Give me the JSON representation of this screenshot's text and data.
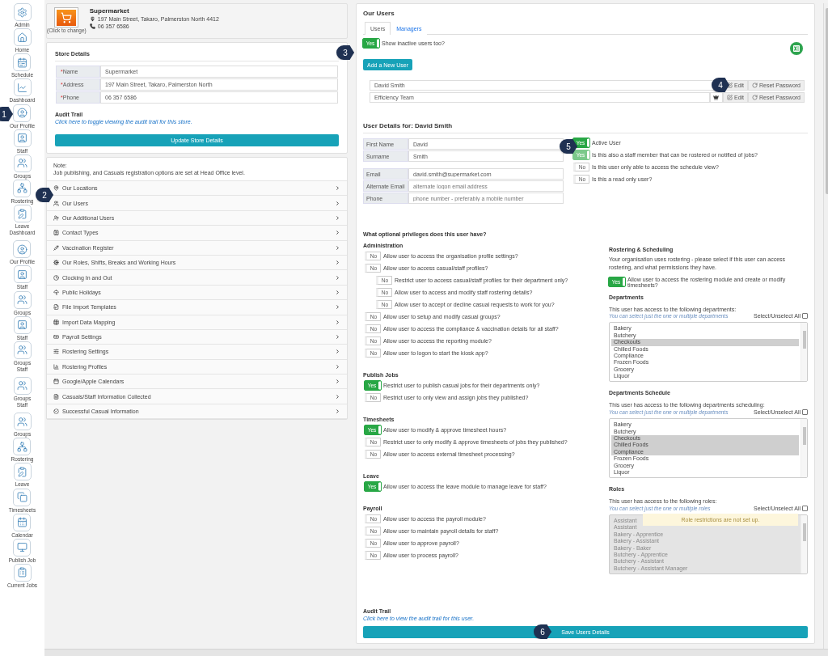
{
  "sidebar": {
    "items": [
      {
        "label": "Admin",
        "kind": "admin"
      },
      {
        "label": "Home",
        "kind": "home"
      },
      {
        "label": "Schedule",
        "kind": "schedule"
      },
      {
        "label": "Dashboard",
        "kind": "dashboard"
      },
      {
        "label": "Our Profile",
        "kind": "profile"
      },
      {
        "label": "Staff",
        "kind": "staff"
      },
      {
        "label": "Groups",
        "kind": "groups"
      },
      {
        "label": "Rostering",
        "kind": "rostering"
      },
      {
        "label": "Leave",
        "kind": "leave"
      },
      {
        "label": "Dashboard",
        "kind": "none"
      },
      {
        "label": "Our Profile",
        "kind": "profile"
      },
      {
        "label": "Staff",
        "kind": "staff"
      },
      {
        "label": "Groups",
        "kind": "groups"
      },
      {
        "label": "Staff",
        "kind": "staff"
      },
      {
        "label": "Groups",
        "kind": "groups"
      },
      {
        "label": "Staff",
        "kind": "none"
      },
      {
        "label": "Groups",
        "kind": "groups"
      },
      {
        "label": "Staff",
        "kind": "none"
      },
      {
        "label": "Groups",
        "kind": "groups"
      },
      {
        "label": "Rostering",
        "kind": "rostering"
      },
      {
        "label": "Leave",
        "kind": "leave"
      },
      {
        "label": "Timesheets",
        "kind": "timesheets"
      },
      {
        "label": "Calendar",
        "kind": "calendar"
      },
      {
        "label": "Publish Job",
        "kind": "publish"
      },
      {
        "label": "Current Jobs",
        "kind": "jobs"
      }
    ]
  },
  "store": {
    "logo_caption": "(Click to change)",
    "name": "Supermarket",
    "address": "197 Main Street, Takaro, Palmerston North 4412",
    "phone": "06 357 6586"
  },
  "store_details": {
    "title": "Store Details",
    "fields": [
      {
        "mark": "*",
        "label": "Name",
        "value": "Supermarket"
      },
      {
        "mark": "*",
        "label": "Address",
        "value": "197 Main Street, Takaro, Palmerston North"
      },
      {
        "mark": "*",
        "label": "Phone",
        "value": "06 357 6586"
      }
    ],
    "audit_title": "Audit Trail",
    "audit_link": "Click here to toggle viewing the audit trail for this store.",
    "button": "Update Store Details"
  },
  "note": {
    "title": "Note:",
    "text": "Job publishing, and Casuals registration options are set at Head Office level."
  },
  "menu": [
    {
      "label": "Our Locations",
      "kind": "location"
    },
    {
      "label": "Our Users",
      "kind": "users"
    },
    {
      "label": "Our Additional Users",
      "kind": "adduser"
    },
    {
      "label": "Contact Types",
      "kind": "contact"
    },
    {
      "label": "Vaccination Register",
      "kind": "vaccine"
    },
    {
      "label": "Our Roles, Shifts, Breaks and Working Hours",
      "kind": "cogs"
    },
    {
      "label": "Clocking In and Out",
      "kind": "clock"
    },
    {
      "label": "Public Holidays",
      "kind": "holiday"
    },
    {
      "label": "File Import Templates",
      "kind": "file"
    },
    {
      "label": "Import Data Mapping",
      "kind": "table"
    },
    {
      "label": "Payroll Settings",
      "kind": "money"
    },
    {
      "label": "Rostering Settings",
      "kind": "sliders"
    },
    {
      "label": "Rostering Profiles",
      "kind": "chart"
    },
    {
      "label": "Google/Apple Calendars",
      "kind": "calendar"
    },
    {
      "label": "Casuals/Staff Information Collected",
      "kind": "doc"
    },
    {
      "label": "Successful Casual Information",
      "kind": "check"
    }
  ],
  "users": {
    "title": "Our Users",
    "tabs": [
      {
        "label": "Users",
        "selected": true
      },
      {
        "label": "Managers",
        "selected": false
      }
    ],
    "show_inactive": {
      "on": true,
      "text": "Yes",
      "label": "Show inactive users too?"
    },
    "add_button": "Add a New User",
    "list": [
      {
        "name": "David Smith",
        "crowned": false,
        "edit": "Edit",
        "reset": "Reset Password"
      },
      {
        "name": "Efficiency Team",
        "crowned": true,
        "edit": "Edit",
        "reset": "Reset Password"
      }
    ]
  },
  "details": {
    "title": "User Details for: David Smith",
    "name_fields": [
      {
        "label": "First Name",
        "value": "David"
      },
      {
        "label": "Surname",
        "value": "Smith"
      }
    ],
    "contact_fields": [
      {
        "label": "Email",
        "value": "david.smith@supermarket.com"
      },
      {
        "label": "Alternate Email",
        "placeholder": "alternate logon email address"
      },
      {
        "label": "Phone",
        "placeholder": "phone number - preferably a mobile number"
      }
    ],
    "flags": [
      {
        "on": true,
        "disabled": false,
        "text": "Yes",
        "label": "Active User"
      },
      {
        "on": true,
        "disabled": true,
        "text": "Yes",
        "label": "Is this also a staff member that can be rostered or notified of jobs?"
      },
      {
        "on": false,
        "disabled": false,
        "text": "No",
        "label": "Is this user only able to access the schedule view?"
      },
      {
        "on": false,
        "disabled": false,
        "text": "No",
        "label": "Is this a read only user?"
      }
    ]
  },
  "privileges": {
    "title": "What optional privileges does this user have?",
    "groups": [
      {
        "title": "Administration",
        "items": [
          {
            "on": false,
            "text": "No",
            "label": "Allow user to access the organisation profile settings?"
          },
          {
            "on": false,
            "text": "No",
            "label": "Allow user to access casual/staff profiles?",
            "children": [
              {
                "on": false,
                "text": "No",
                "label": "Restrict user to access casual/staff profiles for their department only?"
              },
              {
                "on": false,
                "text": "No",
                "label": "Allow user to access and modify staff rostering details?"
              },
              {
                "on": false,
                "text": "No",
                "label": "Allow user to accept or decline casual requests to work for you?"
              }
            ]
          },
          {
            "on": false,
            "text": "No",
            "label": "Allow user to setup and modify casual groups?"
          },
          {
            "on": false,
            "text": "No",
            "label": "Allow user to access the compliance & vaccination details for all staff?"
          },
          {
            "on": false,
            "text": "No",
            "label": "Allow user to access the reporting module?"
          },
          {
            "on": false,
            "text": "No",
            "label": "Allow user to logon to start the kiosk app?"
          }
        ]
      },
      {
        "title": "Publish Jobs",
        "items": [
          {
            "on": true,
            "text": "Yes",
            "label": "Restrict user to publish casual jobs for their departments only?"
          },
          {
            "on": false,
            "text": "No",
            "label": "Restrict user to only view and assign jobs they published?"
          }
        ]
      },
      {
        "title": "Timesheets",
        "items": [
          {
            "on": true,
            "text": "Yes",
            "label": "Allow user to modify & approve timesheet hours?"
          },
          {
            "on": false,
            "text": "No",
            "label": "Restrict user to only modify & approve timesheets of jobs they published?"
          },
          {
            "on": false,
            "text": "No",
            "label": "Allow user to access external timesheet processing?"
          }
        ]
      },
      {
        "title": "Leave",
        "items": [
          {
            "on": true,
            "text": "Yes",
            "label": "Allow user to access the leave module to manage leave for staff?"
          }
        ]
      },
      {
        "title": "Payroll",
        "items": [
          {
            "on": false,
            "text": "No",
            "label": "Allow user to access the payroll module?"
          },
          {
            "on": false,
            "text": "No",
            "label": "Allow user to maintain payroll details for staff?"
          },
          {
            "on": false,
            "text": "No",
            "label": "Allow user to approve payroll?"
          },
          {
            "on": false,
            "text": "No",
            "label": "Allow user to process payroll?"
          }
        ]
      }
    ]
  },
  "rostering": {
    "title": "Rostering & Scheduling",
    "text": "Your organisation uses rostering - please select if this user can access rostering, and what permissions they have.",
    "toggle": {
      "on": true,
      "text": "Yes",
      "label": "Allow user to access the rostering module and create or modify timesheets?"
    },
    "lists": [
      {
        "title": "Departments",
        "intro": "This user has access to the following departments:",
        "hint": "You can select just the one or multiple departments",
        "select_all": "Select/Unselect All",
        "all_checked": false,
        "disabled": false,
        "options": [
          {
            "label": "Bakery",
            "selected": false
          },
          {
            "label": "Butchery",
            "selected": false
          },
          {
            "label": "Checkouts",
            "selected": true
          },
          {
            "label": "Chilled Foods",
            "selected": false
          },
          {
            "label": "Compliance",
            "selected": false
          },
          {
            "label": "Frozen Foods",
            "selected": false
          },
          {
            "label": "Grocery",
            "selected": false
          },
          {
            "label": "Liquor",
            "selected": false
          }
        ]
      },
      {
        "title": "Departments Schedule",
        "intro": "This user has access to the following departments scheduling:",
        "hint": "You can select just the one or multiple departments",
        "select_all": "Select/Unselect All",
        "all_checked": false,
        "disabled": false,
        "options": [
          {
            "label": "Bakery",
            "selected": false
          },
          {
            "label": "Butchery",
            "selected": false
          },
          {
            "label": "Checkouts",
            "selected": true
          },
          {
            "label": "Chilled Foods",
            "selected": true
          },
          {
            "label": "Compliance",
            "selected": true
          },
          {
            "label": "Frozen Foods",
            "selected": false
          },
          {
            "label": "Grocery",
            "selected": false
          },
          {
            "label": "Liquor",
            "selected": false
          }
        ]
      },
      {
        "title": "Roles",
        "intro": "This user has access to the following roles:",
        "hint": "You can select just the one or multiple roles",
        "select_all": "Select/Unselect All",
        "all_checked": false,
        "disabled": true,
        "notice": "Role restrictions are not set up.",
        "options": [
          {
            "label": "Assistant",
            "selected": false
          },
          {
            "label": "Assistant",
            "selected": false
          },
          {
            "label": "Bakery - Apprentice",
            "selected": false
          },
          {
            "label": "Bakery - Assistant",
            "selected": false
          },
          {
            "label": "Bakery - Baker",
            "selected": false
          },
          {
            "label": "Butchery - Apprentice",
            "selected": false
          },
          {
            "label": "Butchery - Assistant",
            "selected": false
          },
          {
            "label": "Butchery - Assistant Manager",
            "selected": false
          }
        ]
      }
    ]
  },
  "user_audit": {
    "title": "Audit Trail",
    "link": "Click here to view the audit trail for this user."
  },
  "save_button": "Save Users Details",
  "callouts": [
    "1",
    "2",
    "3",
    "4",
    "5",
    "6"
  ]
}
